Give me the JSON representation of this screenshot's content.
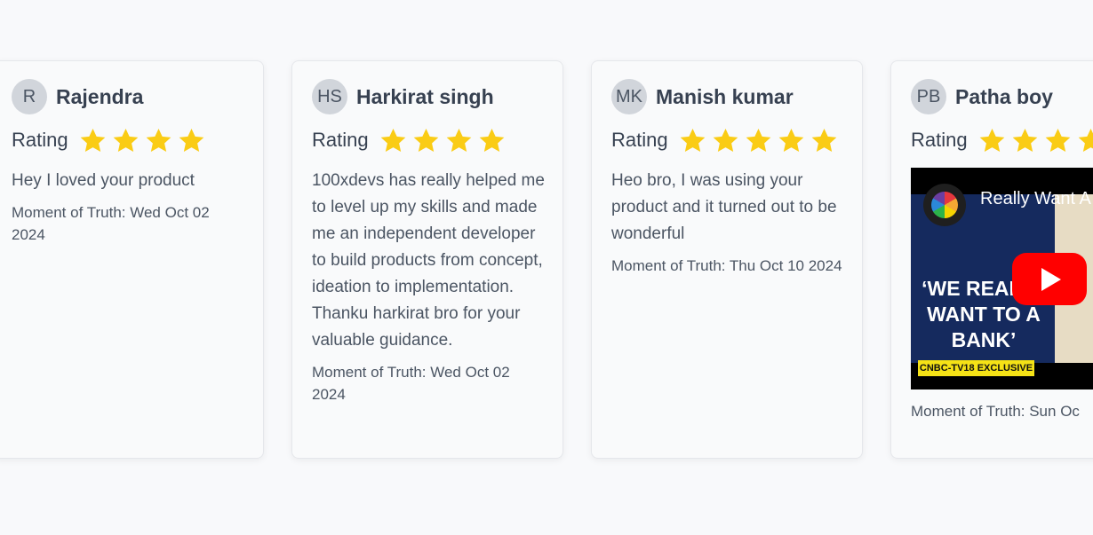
{
  "rating_label": "Rating",
  "star_color": "#facc15",
  "cards": [
    {
      "initials": "R",
      "name": "Rajendra",
      "stars": 4,
      "review": "Hey I loved your product",
      "moment": "Moment of Truth: Wed Oct 02 2024"
    },
    {
      "initials": "HS",
      "name": "Harkirat singh",
      "stars": 4,
      "review": "100xdevs has really helped me to level up my skills and made me an independent developer to build products from concept, ideation to implementation. Thanku harkirat bro for your valuable guidance.",
      "moment": "Moment of Truth: Wed Oct 02 2024"
    },
    {
      "initials": "MK",
      "name": "Manish kumar",
      "stars": 5,
      "review": "Heo bro, I was using your product and it turned out to be wonderful",
      "moment": "Moment of Truth: Thu Oct 10 2024"
    },
    {
      "initials": "PB",
      "name": "Patha boy",
      "stars": 4,
      "video": {
        "title": "Really Want A",
        "channel": "CNBC TV18",
        "headline": "‘WE REALLY WANT TO A BANK’",
        "badge": "CNBC-TV18 EXCLUSIVE"
      },
      "moment": "Moment of Truth: Sun Oc"
    }
  ]
}
